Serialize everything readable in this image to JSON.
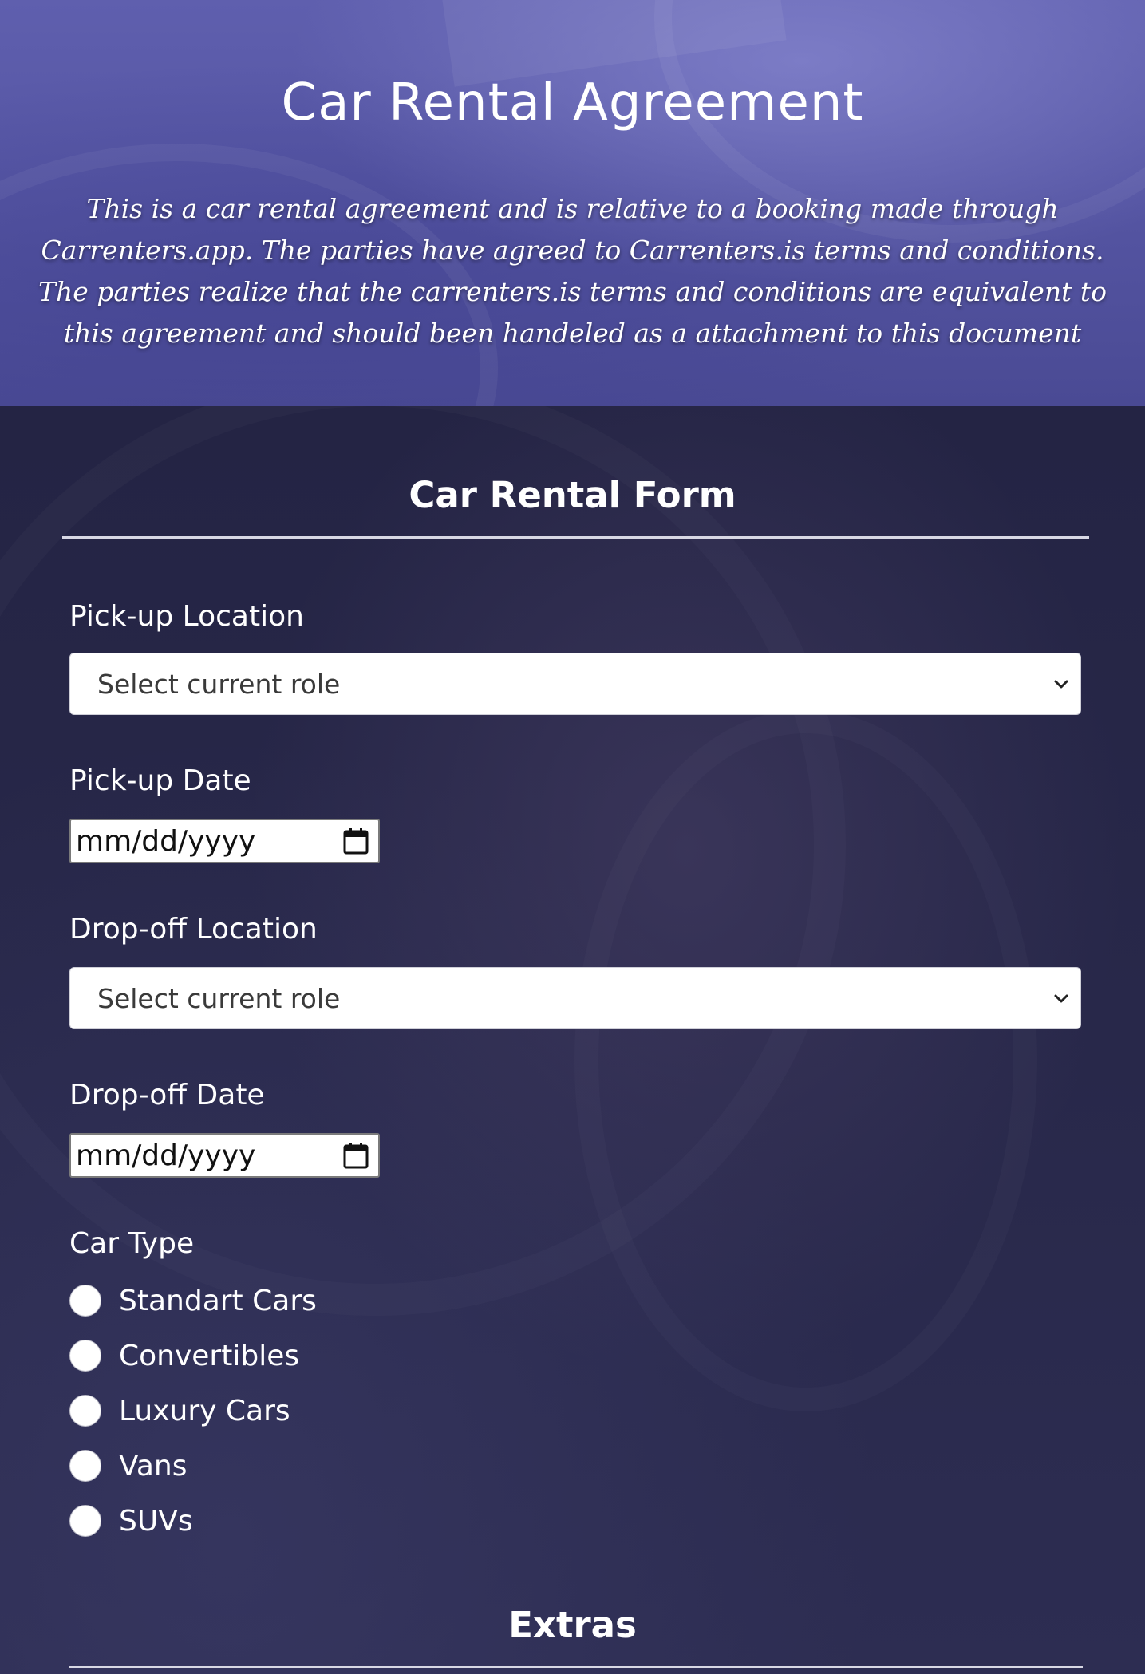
{
  "header": {
    "title": "Car Rental Agreement",
    "intro": "This is a car rental agreement and is relative to a booking made through Carrenters.app. The parties have agreed to Carrenters.is terms and conditions. The parties realize that the carrenters.is terms and conditions are equivalent to this agreement and should been handeled as a attachment to this document"
  },
  "form": {
    "title": "Car Rental Form",
    "pickup_location": {
      "label": "Pick-up Location",
      "selected": "Select current role"
    },
    "pickup_date": {
      "label": "Pick-up Date",
      "value": "mm/dd/yyyy"
    },
    "dropoff_location": {
      "label": "Drop-off Location",
      "selected": "Select current role"
    },
    "dropoff_date": {
      "label": "Drop-off Date",
      "value": "mm/dd/yyyy"
    },
    "car_type": {
      "label": "Car Type",
      "options": [
        "Standart Cars",
        "Convertibles",
        "Luxury Cars",
        "Vans",
        "SUVs"
      ]
    }
  },
  "extras": {
    "title": "Extras"
  },
  "colors": {
    "header_bg": "#5656a4",
    "form_bg": "#28284a",
    "text": "#ffffff",
    "input_bg": "#ffffff"
  },
  "icons": {
    "select_arrow": "chevron-down-icon",
    "date_picker": "calendar-icon"
  }
}
